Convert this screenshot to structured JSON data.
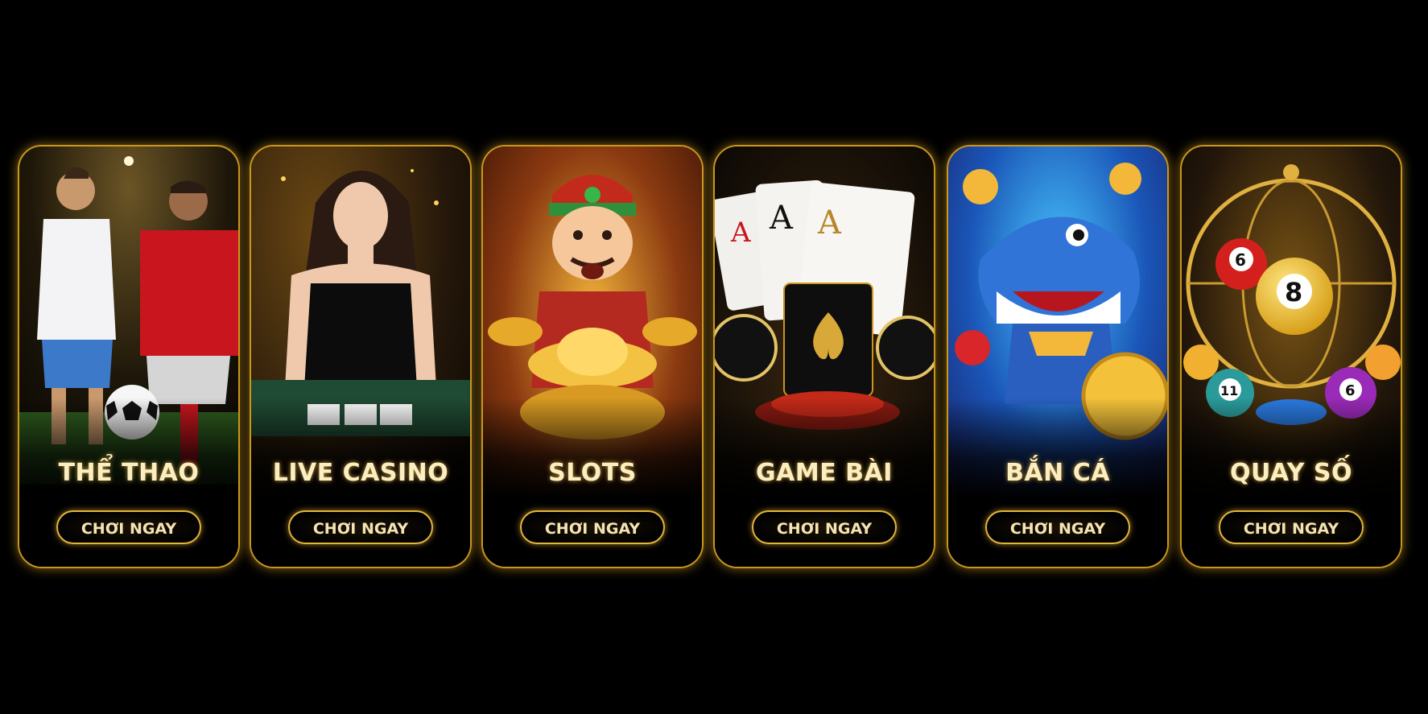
{
  "cards": [
    {
      "title": "THỂ THAO",
      "button_label": "CHƠI NGAY",
      "art": "football-players-art"
    },
    {
      "title": "LIVE CASINO",
      "button_label": "CHƠI NGAY",
      "art": "casino-dealer-art"
    },
    {
      "title": "SLOTS",
      "button_label": "CHƠI NGAY",
      "art": "god-of-wealth-art"
    },
    {
      "title": "GAME BÀI",
      "button_label": "CHƠI NGAY",
      "art": "playing-cards-art"
    },
    {
      "title": "BẮN CÁ",
      "button_label": "CHƠI NGAY",
      "art": "shark-fishing-art"
    },
    {
      "title": "QUAY SỐ",
      "button_label": "CHƠI NGAY",
      "art": "lottery-balls-art"
    }
  ],
  "theme": {
    "background": "#000000",
    "border_gold": "#c9961e",
    "title_color": "#fbeec0"
  }
}
